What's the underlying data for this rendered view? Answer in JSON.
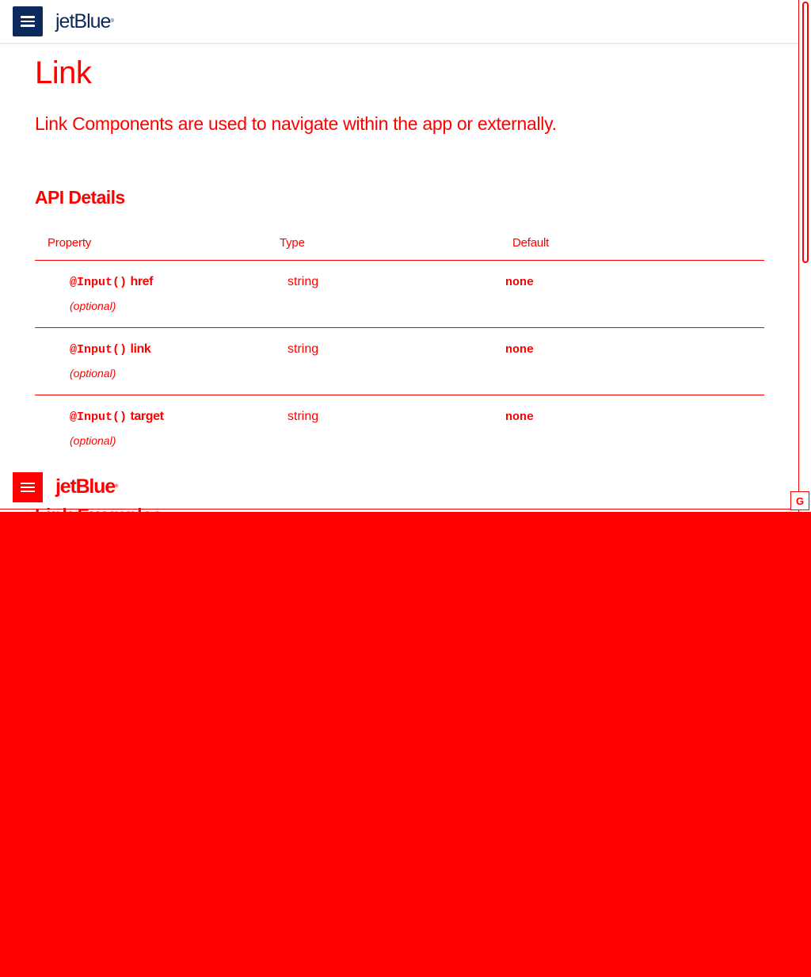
{
  "header": {
    "logo": "jetBlue",
    "logo_mark": "®",
    "menu_icon": "hamburger-icon"
  },
  "page": {
    "title": "Link",
    "lede": "Link Components are used to navigate within the app or externally.",
    "section_title": "API Details"
  },
  "api_table": {
    "columns": [
      "Property",
      "Type",
      "Default"
    ],
    "rows": [
      {
        "decorator": "@Input()",
        "name": "href",
        "optional": "(optional)",
        "type": "string",
        "default": "none"
      },
      {
        "decorator": "@Input()",
        "name": "link",
        "optional": "(optional)",
        "type": "string",
        "default": "none"
      },
      {
        "decorator": "@Input()",
        "name": "target",
        "optional": "(optional)",
        "type": "string",
        "default": "none"
      }
    ]
  },
  "overlay": {
    "logo": "jetBlue",
    "logo_mark": "®",
    "peek_heading": "Link Examples",
    "badge": "G"
  },
  "colors": {
    "brand_navy": "#0b2a5b",
    "highlight_red": "#ff0000"
  }
}
